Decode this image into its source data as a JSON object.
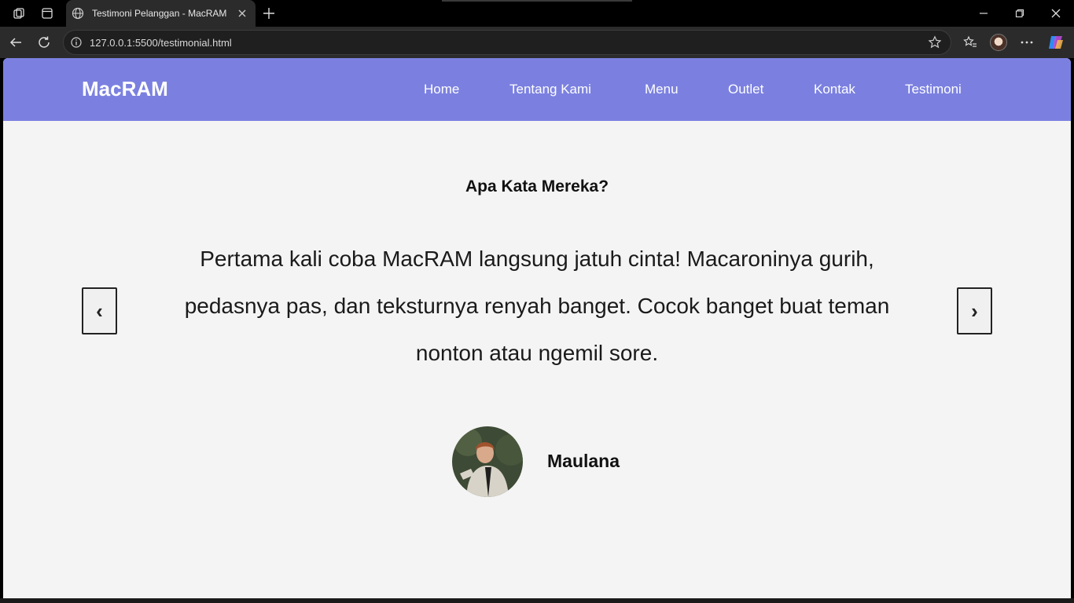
{
  "browser": {
    "tab_title": "Testimoni Pelanggan - MacRAM",
    "url": "127.0.0.1:5500/testimonial.html"
  },
  "site": {
    "brand": "MacRAM",
    "nav": [
      "Home",
      "Tentang Kami",
      "Menu",
      "Outlet",
      "Kontak",
      "Testimoni"
    ]
  },
  "testimonial": {
    "heading": "Apa Kata Mereka?",
    "quote": "Pertama kali coba MacRAM langsung jatuh cinta! Macaroninya gurih, pedasnya pas, dan teksturnya renyah banget. Cocok banget buat teman nonton atau ngemil sore.",
    "author": "Maulana",
    "prev_label": "‹",
    "next_label": "›"
  },
  "colors": {
    "navbar": "#7b80e0",
    "page_bg": "#f4f4f4"
  }
}
